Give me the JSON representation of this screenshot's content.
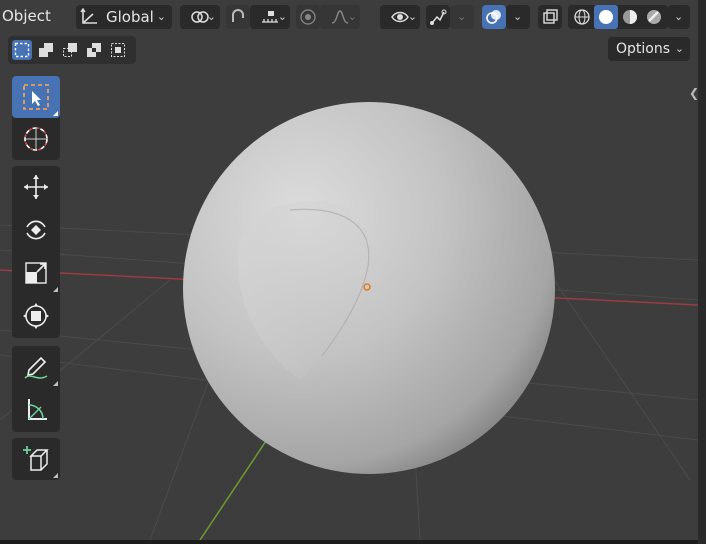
{
  "header": {
    "mode_label": "Object",
    "orientation": {
      "label": "Global",
      "icon": "transform-orientation-icon"
    },
    "pivot_icon": "pivot-point-icon",
    "snap": {
      "magnet_icon": "snap-magnet-icon",
      "increment_icon": "snap-increment-icon"
    },
    "proportional": {
      "toggle_icon": "proportional-editing-icon",
      "falloff_icon": "falloff-curve-icon"
    },
    "visibility_icon": "eye-icon",
    "gizmo_icon": "gizmo-icon",
    "overlays_icon": "overlays-icon",
    "xray_icon": "xray-icon",
    "shading_modes": [
      "wireframe",
      "solid",
      "material-preview",
      "rendered"
    ],
    "active_shading": "solid",
    "options_label": "Options"
  },
  "select_modes": {
    "items": [
      "set",
      "extend",
      "subtract",
      "difference",
      "intersect"
    ],
    "active": "set"
  },
  "toolbar": {
    "tools": [
      {
        "name": "select-box",
        "icon": "select-box-icon",
        "active": true
      },
      {
        "name": "cursor",
        "icon": "cursor-icon",
        "active": false
      },
      {
        "name": "move",
        "icon": "move-icon",
        "active": false
      },
      {
        "name": "rotate",
        "icon": "rotate-icon",
        "active": false
      },
      {
        "name": "scale",
        "icon": "scale-icon",
        "active": false
      },
      {
        "name": "transform",
        "icon": "transform-icon",
        "active": false
      },
      {
        "name": "annotate",
        "icon": "annotate-icon",
        "active": false
      },
      {
        "name": "measure",
        "icon": "measure-icon",
        "active": false
      },
      {
        "name": "add-cube",
        "icon": "add-cube-icon",
        "active": false
      }
    ]
  },
  "scene": {
    "object": "UV sphere",
    "colors": {
      "background": "#3d3d3d",
      "grid": "#4a4a4a",
      "x_axis": "#9b3b46",
      "y_axis": "#6f9a2e",
      "origin": "#e07b1a",
      "active_blue": "#4772b3"
    }
  }
}
